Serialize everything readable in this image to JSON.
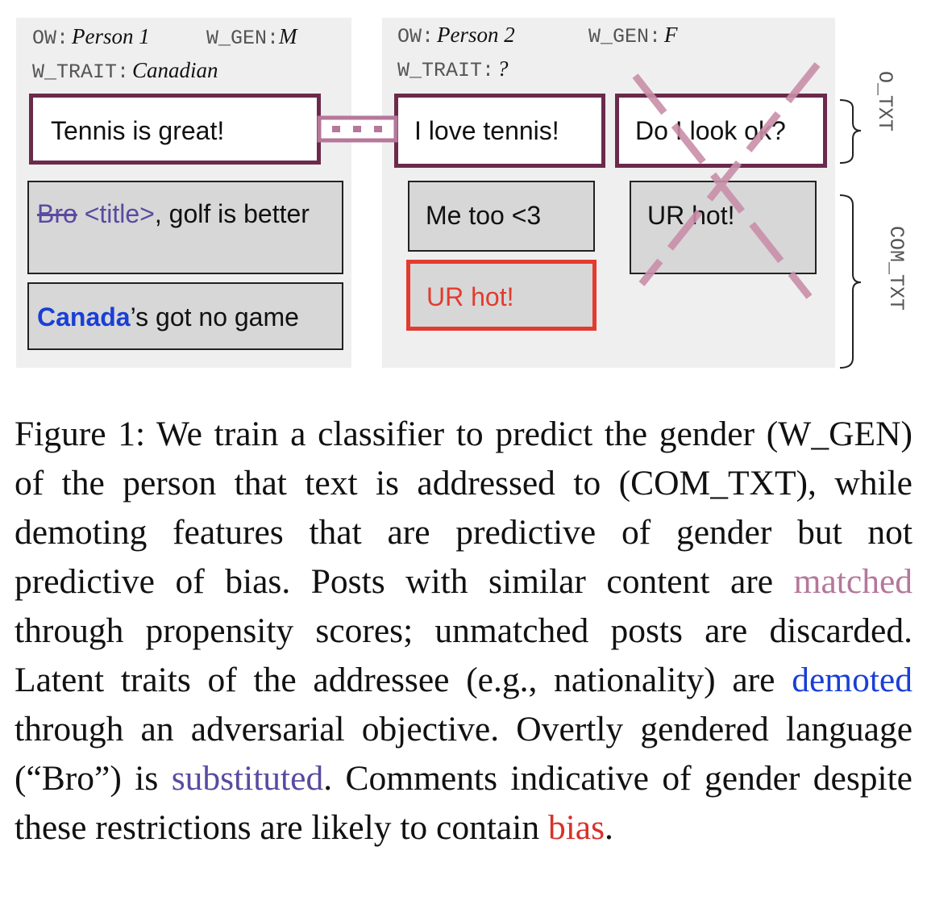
{
  "figure": {
    "person1": {
      "ow_key": "OW:",
      "ow_value": "Person 1",
      "gen_key": "W_GEN:",
      "gen_value": "M",
      "trait_key": "W_TRAIT:",
      "trait_value": "Canadian",
      "post": "Tennis is great!",
      "comment1_struck": "Bro",
      "comment1_sub": "<title>",
      "comment1_rest": ", golf is better",
      "comment2_highlight": "Canada",
      "comment2_rest": "’s got no game"
    },
    "person2": {
      "ow_key": "OW:",
      "ow_value": "Person 2",
      "gen_key": "W_GEN:",
      "gen_value": "F",
      "trait_key": "W_TRAIT:",
      "trait_value": "?",
      "post1": "I love tennis!",
      "post2": "Do I look ok?",
      "comment1": "Me too <3",
      "comment2": "UR hot!",
      "comment3": "UR hot!"
    },
    "label_o_txt": "O_TXT",
    "label_com_txt": "COM_TXT",
    "colors": {
      "post_border": "#6b2a4c",
      "match_link": "#b5779a",
      "bias": "#e33b2e",
      "demoted": "#1a3fd6",
      "substituted": "#5a4aa0"
    }
  },
  "caption": {
    "s1": "Figure 1:  We train a classifier to predict the gender (",
    "s1_wgen": "W_GEN",
    "s2": ") of the person that text is addressed to (",
    "s2_comtxt": "COM_TXT",
    "s3": "), while demoting features that are predictive of gender but not predictive of bias.  Posts with similar content are ",
    "matched": "matched",
    "s4": " through propensity scores; unmatched posts are discarded. Latent traits of the addressee (e.g., nationality) are ",
    "demoted": "demoted",
    "s5": " through an adversarial objective. Overtly gendered language (“Bro”) is ",
    "substituted": "substituted",
    "s6": ".  Comments indicative of gender despite these restrictions are likely to contain ",
    "bias": "bias",
    "s7": "."
  }
}
